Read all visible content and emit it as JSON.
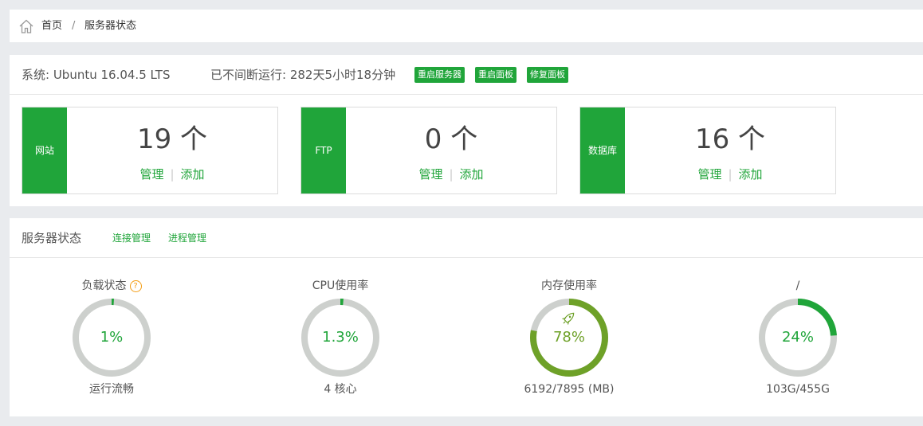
{
  "breadcrumb": {
    "home": "首页",
    "separator": "/",
    "current": "服务器状态"
  },
  "system": {
    "os": "系统: Ubuntu 16.04.5 LTS",
    "uptime": "已不间断运行: 282天5小时18分钟",
    "buttons": {
      "restart_server": "重启服务器",
      "restart_panel": "重启面板",
      "repair_panel": "修复面板"
    }
  },
  "cards": [
    {
      "side": "网站",
      "count": "19 个",
      "manage": "管理",
      "sep": "|",
      "add": "添加"
    },
    {
      "side": "FTP",
      "count": "0 个",
      "manage": "管理",
      "sep": "|",
      "add": "添加"
    },
    {
      "side": "数据库",
      "count": "16 个",
      "manage": "管理",
      "sep": "|",
      "add": "添加"
    }
  ],
  "status": {
    "title": "服务器状态",
    "links": {
      "connections": "连接管理",
      "processes": "进程管理"
    },
    "help_icon": "?",
    "gauges": [
      {
        "label": "负载状态",
        "percent_text": "1%",
        "value": 1,
        "sub": "运行流畅",
        "color": "#20a53a",
        "text_color": "#20a53a"
      },
      {
        "label": "CPU使用率",
        "percent_text": "1.3%",
        "value": 1.3,
        "sub": "4 核心",
        "color": "#20a53a",
        "text_color": "#20a53a"
      },
      {
        "label": "内存使用率",
        "percent_text": "78%",
        "value": 78,
        "sub": "6192/7895 (MB)",
        "color": "#6ea128",
        "text_color": "#6ea128",
        "icon": "rocket-icon"
      },
      {
        "label": "/",
        "percent_text": "24%",
        "value": 24,
        "sub": "103G/455G",
        "color": "#20a53a",
        "text_color": "#20a53a"
      }
    ]
  },
  "colors": {
    "accent": "#20a53a",
    "track": "#cdd0cd",
    "help": "#f39c12"
  }
}
